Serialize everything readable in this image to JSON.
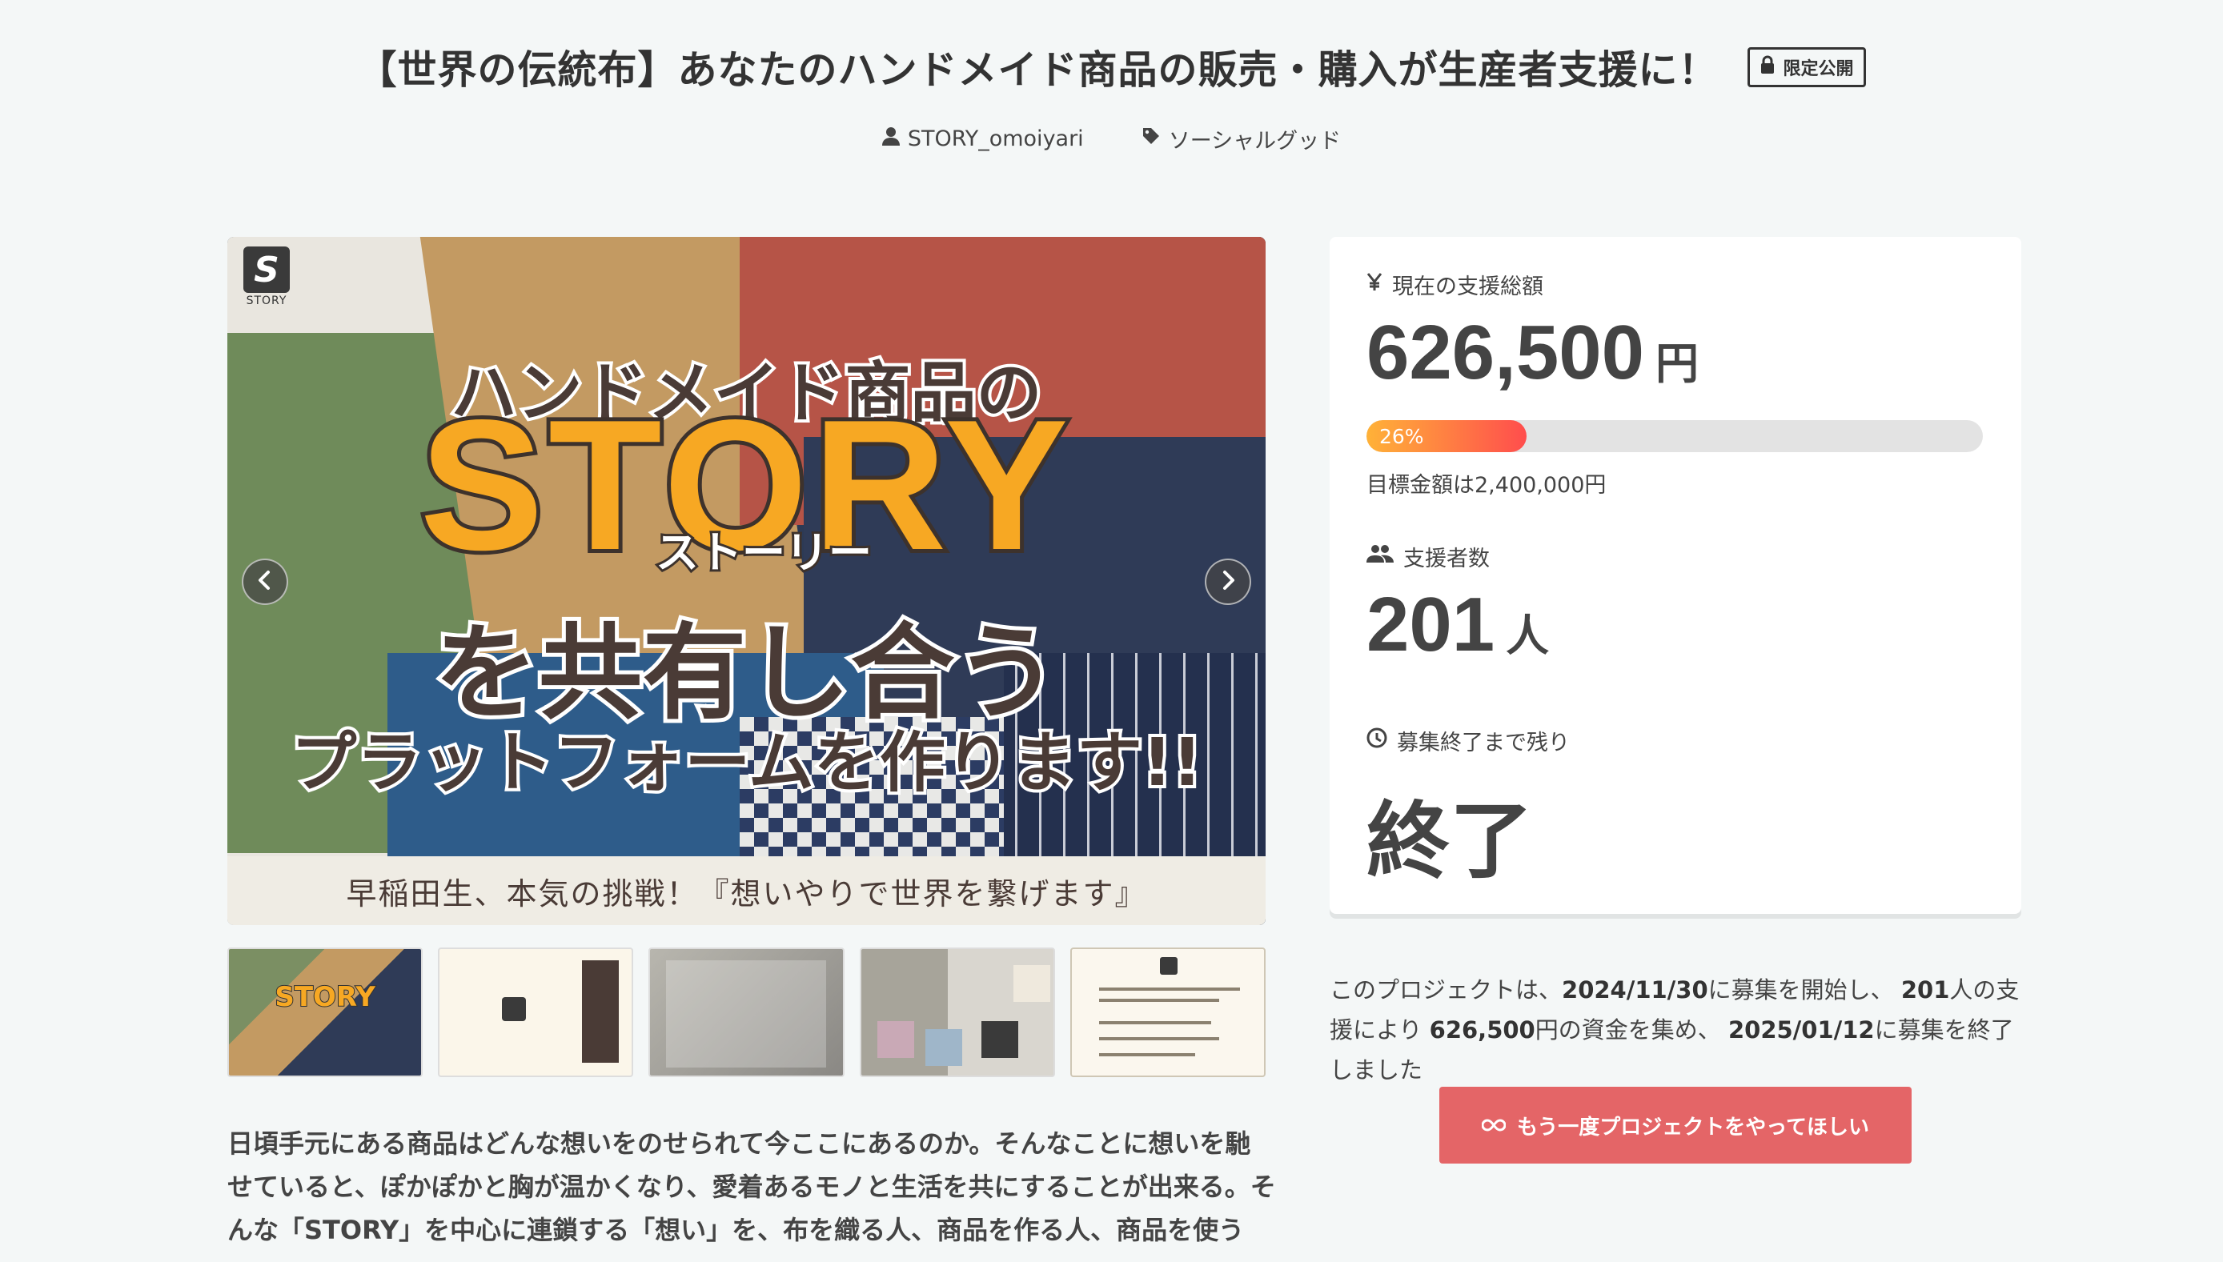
{
  "project": {
    "title": "【世界の伝統布】あなたのハンドメイド商品の販売・購入が生産者支援に！",
    "badge": "限定公開",
    "owner": "STORY_omoiyari",
    "category": "ソーシャルグッド"
  },
  "hero": {
    "logo_letter": "S",
    "logo_word": "STORY",
    "line1": "ハンドメイド商品の",
    "story": "STORY",
    "kana": "ストーリー",
    "line3": "を共有し合う",
    "line4": "プラットフォームを作ります!!",
    "caption": "早稲田生、本気の挑戦！『想いやりで世界を繋げます』"
  },
  "thumbnails": {
    "t1": "STORY"
  },
  "description": "日頃手元にある商品はどんな想いをのせられて今ここにあるのか。そんなことに想いを馳せていると、ぽかぽかと胸が温かくなり、愛着あるモノと生活を共にすることが出来る。そんな「STORY」を中心に連鎖する「想い」を、布を織る人、商品を作る人、商品を使う",
  "stats": {
    "total_label": "現在の支援総額",
    "total_value": "626,500",
    "total_unit": "円",
    "progress_percent": 26,
    "progress_text": "26%",
    "goal_text": "目標金額は2,400,000円",
    "supporters_label": "支援者数",
    "supporters_value": "201",
    "supporters_unit": "人",
    "remaining_label": "募集終了まで残り",
    "remaining_value": "終了"
  },
  "summary": {
    "p1": "このプロジェクトは、",
    "start_date": "2024/11/30",
    "p2": "に募集を開始し、",
    "supporters": "201",
    "p3": "人の支援により",
    "amount": "626,500",
    "p4": "円の資金を集め、",
    "end_date": "2025/01/12",
    "p5": "に募集を終了しました"
  },
  "cta": {
    "label": "もう一度プロジェクトをやってほしい"
  },
  "colors": {
    "accent": "#e46567",
    "progress_start": "#ffb238",
    "progress_end": "#ff4d4d",
    "background": "#f4f7f7"
  },
  "icons": [
    "lock-icon",
    "user-icon",
    "tag-icon",
    "yen-icon",
    "users-icon",
    "clock-icon",
    "chevron-left-icon",
    "chevron-right-icon",
    "infinity-icon"
  ]
}
